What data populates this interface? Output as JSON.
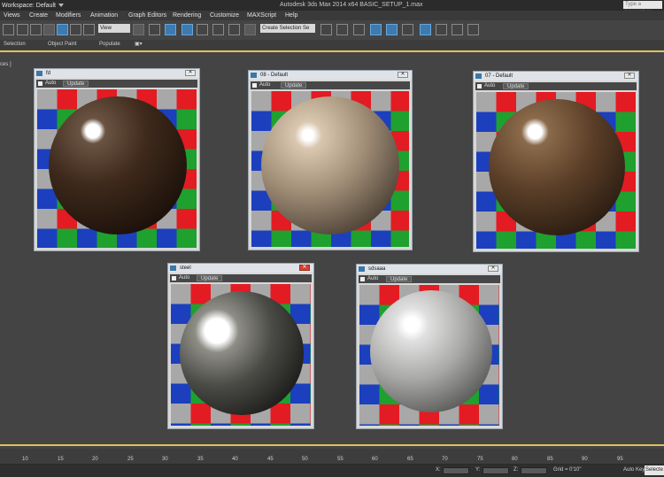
{
  "window": {
    "workspace": "Workspace: Default",
    "title": "Autodesk 3ds Max  2014 x64      BASIC_SETUP_1.max",
    "search_placeholder": "Type a keyword or phrase"
  },
  "menu": [
    "Views",
    "Create",
    "Modifiers",
    "Animation",
    "Graph Editors",
    "Rendering",
    "Customize",
    "MAXScript",
    "Help"
  ],
  "toolbar": {
    "view_dropdown": "View",
    "selection_set": "Create Selection Se"
  },
  "ribbon": {
    "items": [
      "Selection",
      "Object Paint",
      "Populate"
    ]
  },
  "viewport": {
    "label": "ces ]"
  },
  "material_windows": [
    {
      "title": "fd",
      "auto_label": "Auto",
      "update_label": "Update"
    },
    {
      "title": "08 - Default",
      "auto_label": "Auto",
      "update_label": "Update"
    },
    {
      "title": "07 - Default",
      "auto_label": "Auto",
      "update_label": "Update"
    },
    {
      "title": "steel",
      "auto_label": "Auto",
      "update_label": "Update"
    },
    {
      "title": "sdsaaa",
      "auto_label": "Auto",
      "update_label": "Update"
    }
  ],
  "timeline": {
    "ticks": [
      "10",
      "15",
      "20",
      "25",
      "30",
      "35",
      "40",
      "45",
      "50",
      "55",
      "60",
      "65",
      "70",
      "75",
      "80",
      "85",
      "90",
      "95"
    ]
  },
  "status": {
    "x_label": "X:",
    "y_label": "Y:",
    "z_label": "Z:",
    "grid": "Grid = 0'10\"",
    "auto_key": "Auto Key",
    "selected": "Selecte"
  },
  "colors": {
    "viewport_border": "#e0c05a",
    "active_tool": "#3d7ab0",
    "checker_red": "#e31b23",
    "checker_green": "#1fa12f",
    "checker_blue": "#1c3fbd",
    "checker_gray": "#a8a8a8"
  }
}
